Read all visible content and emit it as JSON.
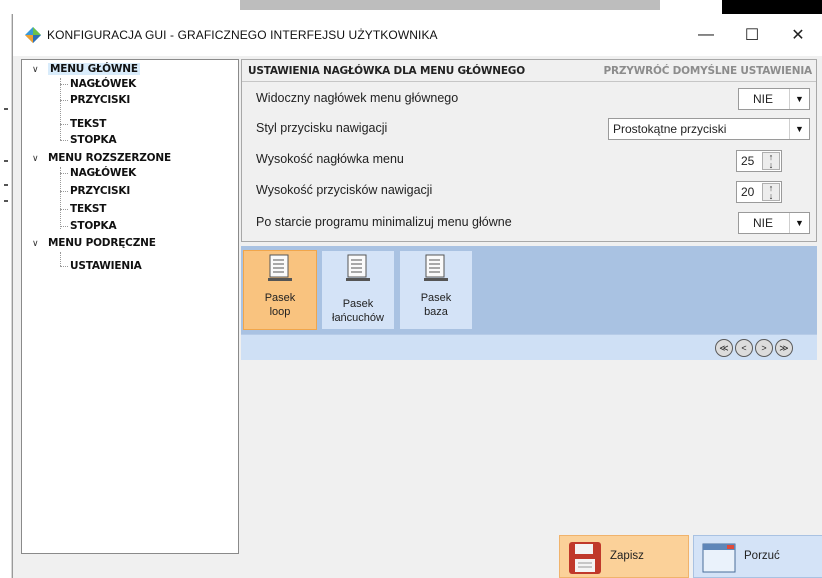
{
  "window": {
    "title": "KONFIGURACJA GUI - GRAFICZNEGO INTERFEJSU UŻYTKOWNIKA",
    "minimize_glyph": "—",
    "maximize_glyph": "☐",
    "close_glyph": "✕"
  },
  "tree": {
    "groups": [
      {
        "label": "MENU GŁÓWNE",
        "selected": true,
        "children": [
          "NAGŁÓWEK",
          "PRZYCISKI",
          "TEKST",
          "STOPKA"
        ]
      },
      {
        "label": "MENU ROZSZERZONE",
        "selected": false,
        "children": [
          "NAGŁÓWEK",
          "PRZYCISKI",
          "TEKST",
          "STOPKA"
        ]
      },
      {
        "label": "MENU PODRĘCZNE",
        "selected": false,
        "children": [
          "USTAWIENIA"
        ]
      }
    ]
  },
  "settings": {
    "title": "USTAWIENIA NAGŁÓWKA DLA MENU GŁÓWNEGO",
    "reset_label": "PRZYWRÓĆ DOMYŚLNE USTAWIENIA",
    "rows": [
      {
        "label": "Widoczny nagłówek menu głównego",
        "value": "NIE"
      },
      {
        "label": "Styl przycisku nawigacji",
        "value": "Prostokątne przyciski"
      },
      {
        "label": "Wysokość nagłówka menu",
        "value": "25"
      },
      {
        "label": "Wysokość przycisków nawigacji",
        "value": "20"
      },
      {
        "label": "Po starcie programu minimalizuj menu główne",
        "value": "NIE"
      }
    ]
  },
  "gallery": {
    "tiles": [
      {
        "label": "Pasek\nloop",
        "active": true
      },
      {
        "label": "Pasek\nłańcuchów",
        "active": false
      },
      {
        "label": "Pasek\nbaza",
        "active": false
      }
    ],
    "nav": [
      "≪",
      "<",
      ">",
      "≫"
    ]
  },
  "buttons": {
    "save_label": "Zapisz",
    "discard_label": "Porzuć"
  },
  "colors": {
    "accent_orange": "#f9c37f",
    "accent_blue": "#a9c2e2",
    "selection": "#d9ecfb"
  }
}
